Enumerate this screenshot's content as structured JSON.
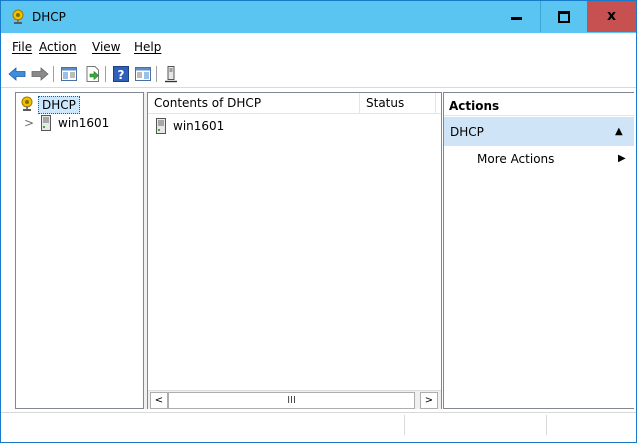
{
  "window": {
    "title": "DHCP",
    "icon": "dhcp-snapin-icon",
    "controls": {
      "minimize": "minimize-icon",
      "maximize": "maximize-icon",
      "close_glyph": "x"
    }
  },
  "menu": {
    "file": "File",
    "action": "Action",
    "view": "View",
    "help": "Help"
  },
  "toolbar": [
    "back-arrow-icon",
    "forward-arrow-icon",
    "show-hide-console-tree-icon",
    "export-list-icon",
    "help-icon",
    "show-hide-action-pane-icon",
    "authorize-server-icon"
  ],
  "tree": {
    "root": {
      "label": "DHCP",
      "icon": "dhcp-snapin-icon"
    },
    "children": [
      {
        "label": "win1601",
        "icon": "server-icon",
        "expander": ">"
      }
    ]
  },
  "list": {
    "columns": [
      "Contents of DHCP",
      "Status"
    ],
    "rows": [
      {
        "name": "win1601",
        "status": "",
        "icon": "server-icon"
      }
    ],
    "hscroll": {
      "left": "<",
      "thumb": "III",
      "right": ">"
    }
  },
  "actions": {
    "header": "Actions",
    "section": {
      "title": "DHCP",
      "collapse_glyph": "▲"
    },
    "items": [
      {
        "label": "More Actions",
        "arrow_glyph": "▶"
      }
    ]
  },
  "colors": {
    "titlebar": "#5bc5f2",
    "close_button": "#c75050",
    "selection": "#cce8ff",
    "actions_section": "#cfe4f6"
  }
}
